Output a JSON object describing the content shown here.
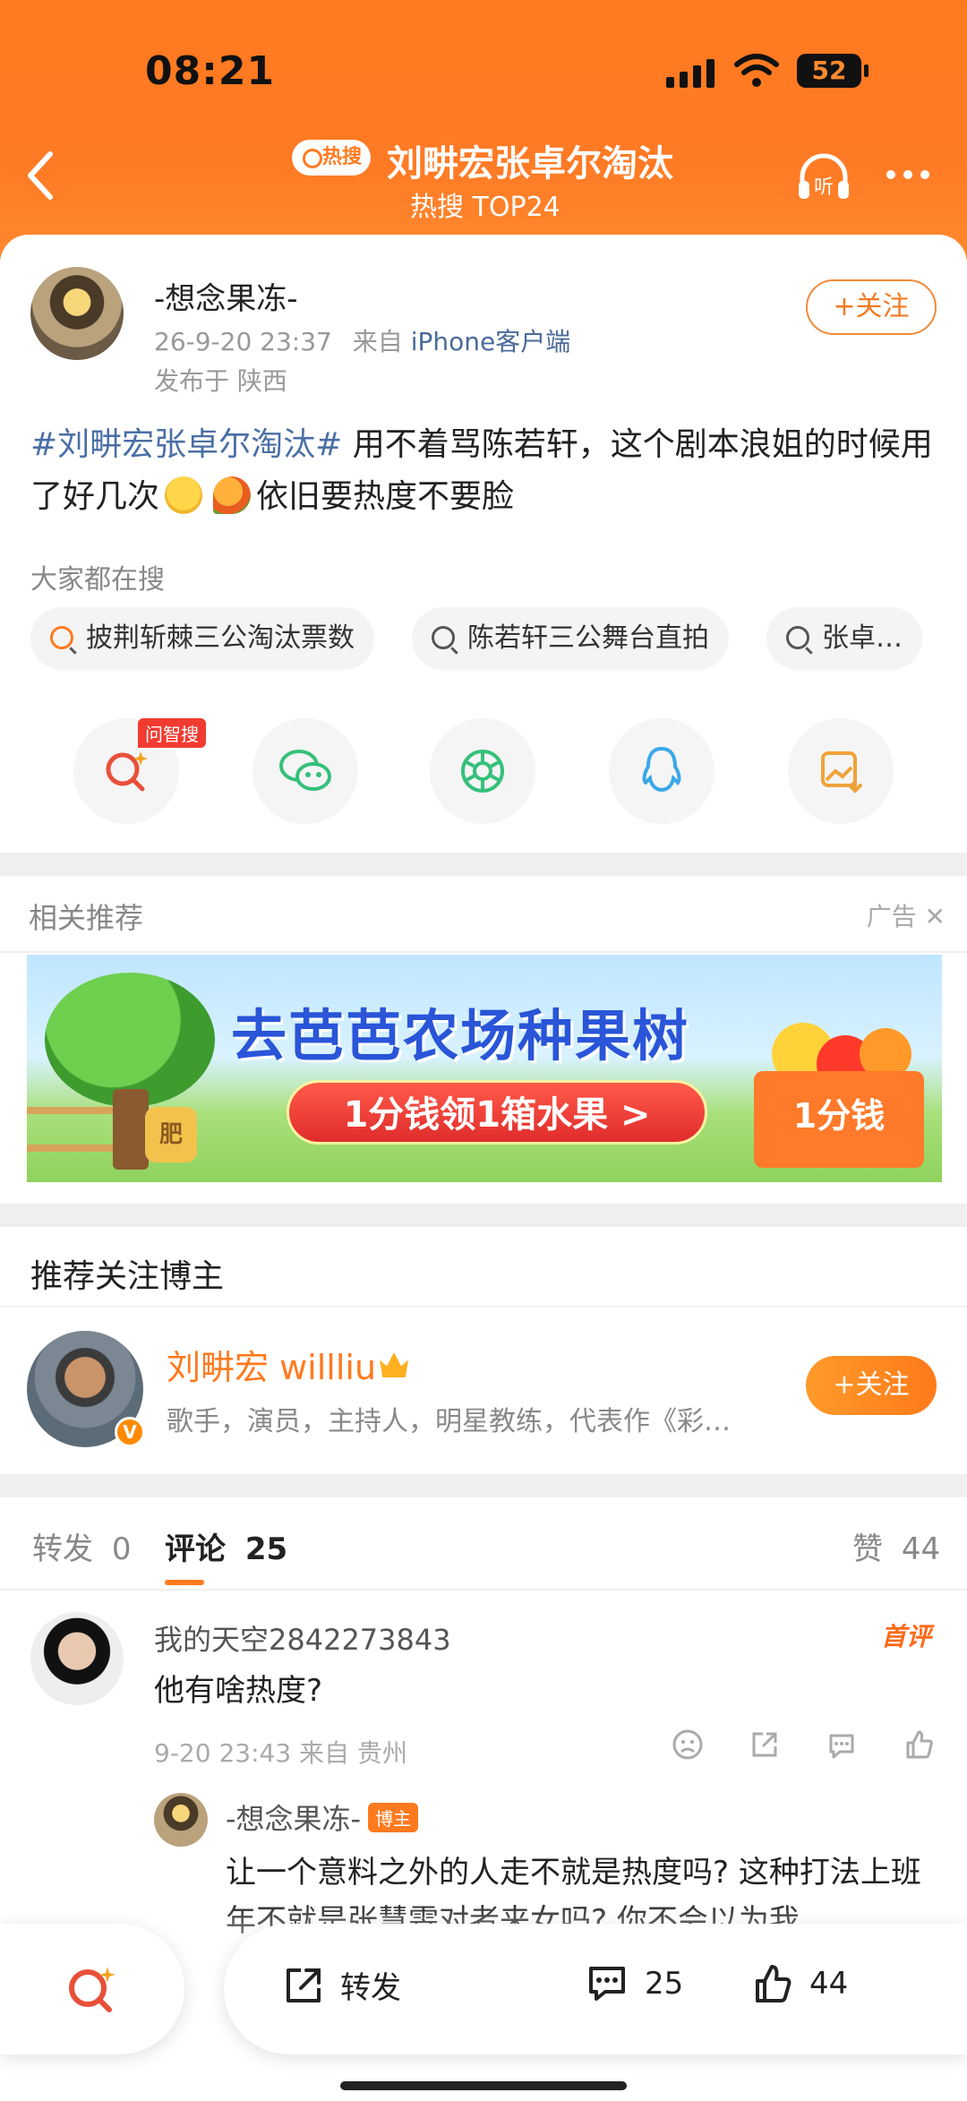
{
  "status_bar": {
    "time": "08:21",
    "battery": "52"
  },
  "header": {
    "hot_badge": "热搜",
    "title": "刘畊宏张卓尔淘汰",
    "subtitle": "热搜 TOP24"
  },
  "post": {
    "username": "-想念果冻-",
    "timestamp": "26-9-20 23:37",
    "source_prefix": "来自",
    "source": "iPhone客户端",
    "location": "发布于 陕西",
    "follow_label": "+关注",
    "hashtag": "#刘畊宏张卓尔淘汰#",
    "text_1": "用不着骂陈若轩，这个剧本浪姐的时候用了好几次",
    "text_2": "依旧要热度不要脸",
    "search_label": "大家都在搜",
    "chips": [
      "披荆斩棘三公淘汰票数",
      "陈若轩三公舞台直拍",
      "张卓…"
    ],
    "ask_tag": "问智搜"
  },
  "recommend": {
    "title": "相关推荐",
    "ad_label": "广告",
    "banner_headline": "去芭芭农场种果树",
    "banner_pill": "1分钱领1箱水果 >",
    "banner_box": "1分钱",
    "banner_jar": "肥"
  },
  "blogger": {
    "heading": "推荐关注博主",
    "name": "刘畊宏 willliu",
    "desc": "歌手，演员，主持人，明星教练，代表作《彩…",
    "follow_label": "+关注",
    "verified": "V"
  },
  "comments": {
    "tab_repost": "转发",
    "tab_repost_count": "0",
    "tab_comment": "评论",
    "tab_comment_count": "25",
    "tab_like": "赞",
    "tab_like_count": "44",
    "c1_user": "我的天空2842273843",
    "c1_tag": "首评",
    "c1_text": "他有啥热度?",
    "c1_meta": "9-20 23:43 来自 贵州",
    "reply_user": "-想念果冻-",
    "reply_tag": "博主",
    "reply_text": "让一个意料之外的人走不就是热度吗? 这种打法上班年不就是张慧雯对者来女吗? 你不会以为我"
  },
  "bottom_bar": {
    "repost_label": "转发",
    "comment_count": "25",
    "like_count": "44"
  },
  "colors": {
    "accent": "#ff7a1f",
    "link": "#4a6fa5"
  }
}
